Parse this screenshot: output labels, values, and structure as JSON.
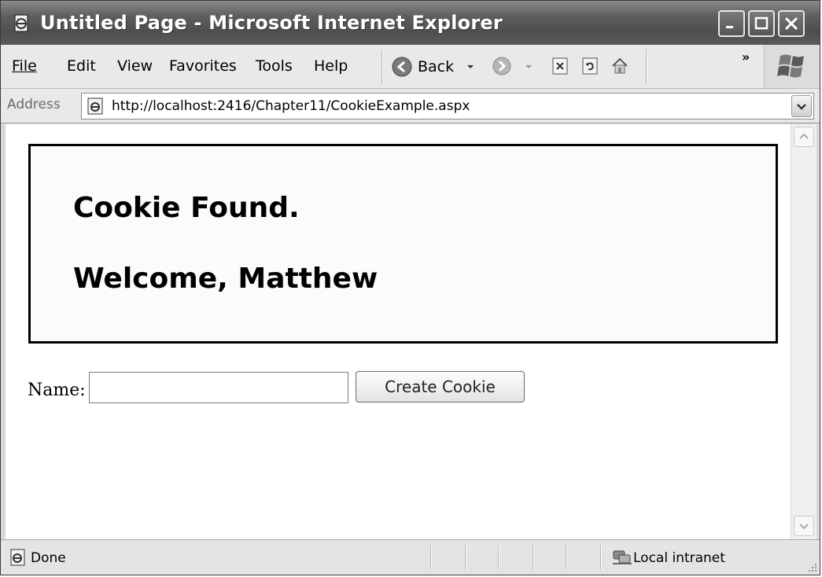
{
  "window": {
    "title": "Untitled Page - Microsoft Internet Explorer"
  },
  "menu": {
    "items": [
      "File",
      "Edit",
      "View",
      "Favorites",
      "Tools",
      "Help"
    ]
  },
  "toolbar": {
    "back_label": "Back",
    "more_label": "»"
  },
  "address": {
    "label": "Address",
    "url": "http://localhost:2416/Chapter11/CookieExample.aspx"
  },
  "page": {
    "heading_line1": "Cookie Found.",
    "heading_line2": "Welcome, Matthew",
    "name_label": "Name:",
    "name_value": "",
    "create_button": "Create Cookie"
  },
  "status": {
    "text": "Done",
    "zone": "Local intranet"
  }
}
